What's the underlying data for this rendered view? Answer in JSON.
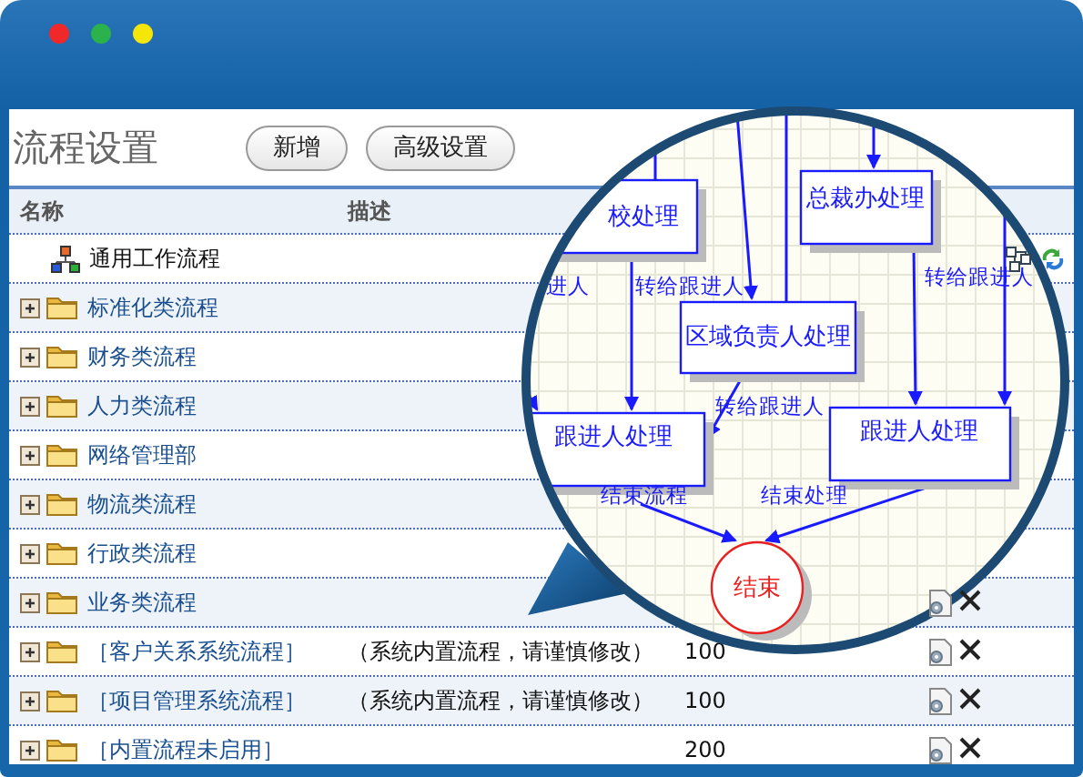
{
  "window": {
    "title": "流程设置"
  },
  "buttons": [
    {
      "label": "新增"
    },
    {
      "label": "高级设置"
    }
  ],
  "table": {
    "columns": [
      "名称",
      "描述"
    ],
    "rows": [
      {
        "name": "通用工作流程",
        "kind": "workflow",
        "actions": [
          {
            "kind": "flowchart"
          },
          {
            "kind": "refresh"
          }
        ]
      },
      {
        "name": "标准化类流程",
        "kind": "folder"
      },
      {
        "name": "财务类流程",
        "kind": "folder"
      },
      {
        "name": "人力类流程",
        "kind": "folder"
      },
      {
        "name": "网络管理部",
        "kind": "folder"
      },
      {
        "name": "物流类流程",
        "kind": "folder"
      },
      {
        "name": "行政类流程",
        "kind": "folder"
      },
      {
        "name": "业务类流程",
        "kind": "folder",
        "actions": [
          {
            "kind": "edit"
          },
          {
            "kind": "delete"
          }
        ]
      },
      {
        "name": "［客户关系系统流程］",
        "kind": "folder",
        "description": "（系统内置流程，请谨慎修改）",
        "column_3": "100",
        "actions": [
          {
            "kind": "edit"
          },
          {
            "kind": "delete"
          }
        ]
      },
      {
        "name": "［项目管理系统流程］",
        "kind": "folder",
        "description": "（系统内置流程，请谨慎修改）",
        "column_3": "100",
        "actions": [
          {
            "kind": "edit"
          },
          {
            "kind": "delete"
          }
        ]
      },
      {
        "name": "［内置流程未启用］",
        "kind": "folder",
        "column_3": "200",
        "actions": [
          {
            "kind": "edit"
          },
          {
            "kind": "delete"
          }
        ]
      }
    ]
  },
  "magnifier": {
    "nodes": [
      {
        "label": "校处理",
        "kind": "task"
      },
      {
        "label": "总裁办处理",
        "kind": "task"
      },
      {
        "label": "区域负责人处理",
        "kind": "task"
      },
      {
        "label": "跟进人处理",
        "kind": "task"
      },
      {
        "label": "跟进人处理",
        "kind": "task"
      },
      {
        "label": "结束",
        "kind": "end"
      }
    ],
    "edge_labels": [
      "进人",
      "转给跟进人",
      "转给跟进人",
      "转给跟进人",
      "结束流程",
      "结束处理"
    ]
  }
}
